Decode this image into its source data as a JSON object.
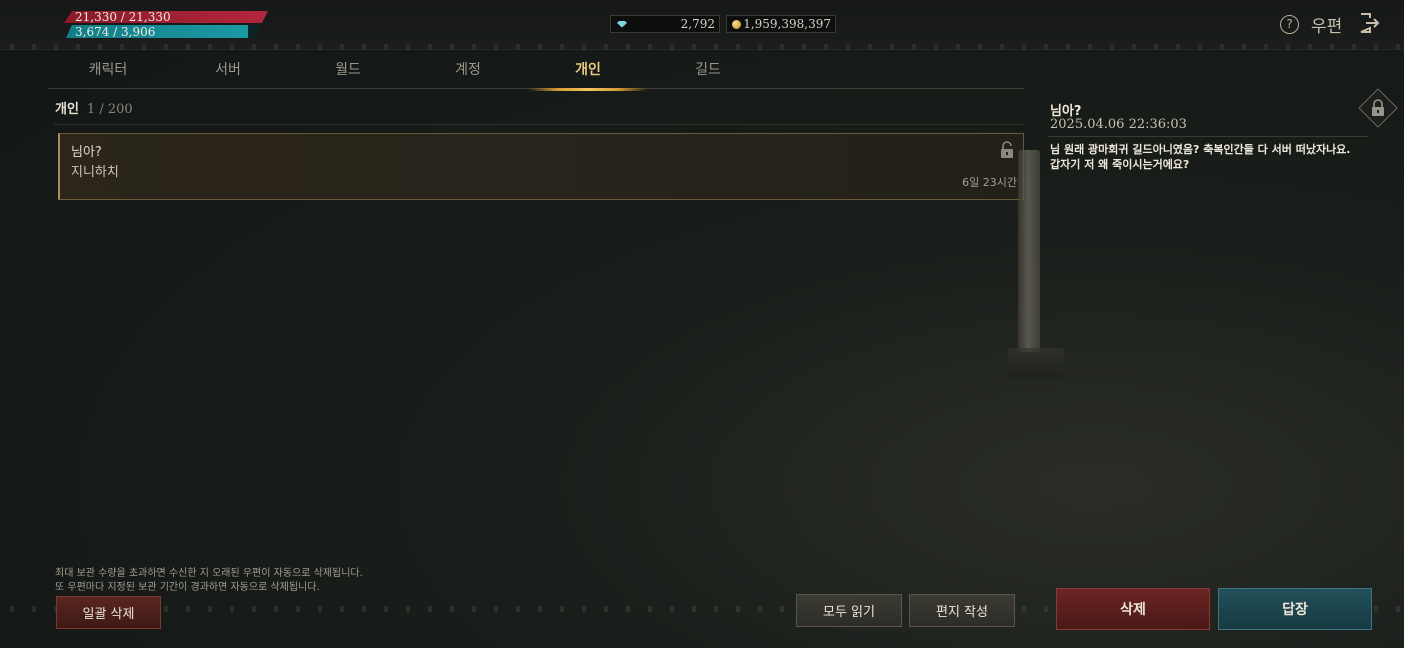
{
  "status": {
    "hp_text": "21,330 / 21,330",
    "mp_text": "3,674 / 3,906",
    "hp_fill": 1.0,
    "mp_fill": 0.94
  },
  "currency": {
    "gem_icon": "diamond-icon",
    "gem_value": "2,792",
    "gold_icon": "coin-icon",
    "gold_value": "1,959,398,397"
  },
  "header": {
    "help_icon": "?",
    "title": "우편",
    "exit_icon": "exit-icon"
  },
  "tabs": [
    {
      "label": "캐릭터",
      "active": false
    },
    {
      "label": "서버",
      "active": false
    },
    {
      "label": "월드",
      "active": false
    },
    {
      "label": "계정",
      "active": false
    },
    {
      "label": "개인",
      "active": true
    },
    {
      "label": "길드",
      "active": false
    }
  ],
  "list": {
    "label": "개인",
    "count": "1 / 200",
    "items": [
      {
        "sender": "님아?",
        "subject": "지니하치",
        "remaining": "6일 23시간",
        "icon": "unlocked-icon"
      }
    ]
  },
  "detail": {
    "sender": "님아?",
    "date": "2025.04.06 22:36:03",
    "body_lines": [
      "님 원래 광마회귀 길드아니였음? 축복인간들 다 서버 떠났자나요.",
      "갑자기 저 왜 죽이시는거에요?"
    ],
    "lock_icon": "lock-icon"
  },
  "footer": {
    "note_lines": [
      "최대 보관 수량을 초과하면 수신한 지 오래된 우편이 자동으로 삭제됩니다.",
      "또 우편마다 지정된 보관 기간이 경과하면 자동으로 삭제됩니다."
    ],
    "bulk_delete": "일괄 삭제",
    "read_all": "모두 읽기",
    "write_letter": "편지 작성",
    "delete": "삭제",
    "reply": "답장"
  },
  "colors": {
    "accent_gold": "#e9c77a",
    "hp_red": "#b3263c",
    "mp_teal": "#1b9aa4"
  }
}
